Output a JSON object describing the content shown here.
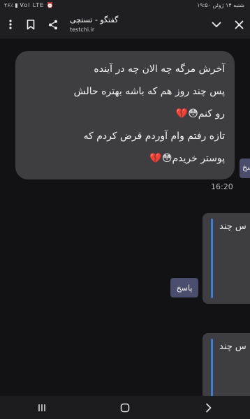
{
  "status_bar": {
    "time": "شنبه ۱۴ ژوئن ۱۹:۵۰",
    "indicators": "۲۶٪ ▮ Vol LTE ⏰"
  },
  "header": {
    "title": "گفتگو - تستچی",
    "subtitle": "testchi.ir"
  },
  "message": {
    "lines": [
      "آخرش مرگه چه الان چه در آینده",
      "پس چند روز هم که باشه بهتره حالش",
      "رو کنم😳💔",
      "تازه رفتم وام آوردم قرض کردم که",
      "پوستر خریدم😳💔"
    ],
    "time": "16:20"
  },
  "side_tab_label": "پاسخ",
  "quoted_replies": [
    {
      "text": "س چند"
    },
    {
      "text": "س چند"
    }
  ],
  "reply_button_label": "پاسخ",
  "icons": {
    "menu": "vertical-dots-icon",
    "bookmark": "bookmark-icon",
    "share": "share-icon",
    "collapse": "chevron-down-icon",
    "close": "close-icon",
    "nav_recents": "recents-icon",
    "nav_home": "home-icon",
    "nav_back": "back-icon"
  },
  "colors": {
    "background": "#121214",
    "bubble": "#3e3e42",
    "accent_bar": "#3b7fd6",
    "button": "#4a4d6b"
  }
}
